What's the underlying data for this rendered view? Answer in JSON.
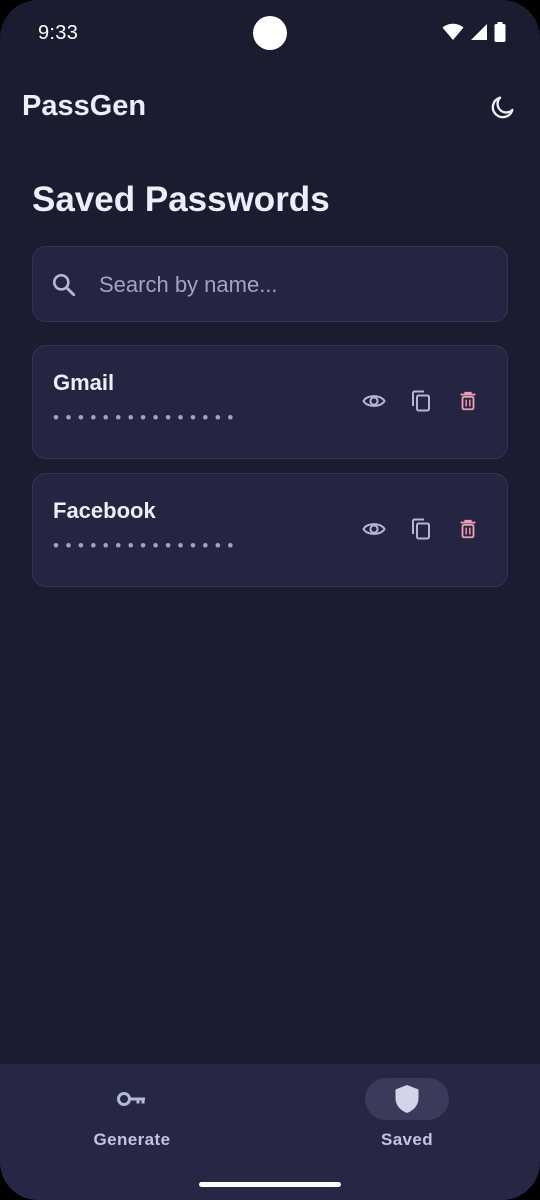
{
  "status_bar": {
    "time": "9:33"
  },
  "app": {
    "title": "PassGen"
  },
  "page": {
    "title": "Saved Passwords"
  },
  "search": {
    "placeholder": "Search by name...",
    "value": ""
  },
  "passwords": [
    {
      "name": "Gmail",
      "masked": "•••••••••••••••",
      "actions": [
        "eye-icon",
        "copy-icon",
        "trash-icon"
      ]
    },
    {
      "name": "Facebook",
      "masked": "•••••••••••••••",
      "actions": [
        "eye-icon",
        "copy-icon",
        "trash-icon"
      ]
    }
  ],
  "bottom_nav": {
    "items": [
      {
        "label": "Generate",
        "icon": "key-icon",
        "active": false
      },
      {
        "label": "Saved",
        "icon": "shield-icon",
        "active": true
      }
    ]
  },
  "colors": {
    "background": "#1c1c30",
    "surface": "#252541",
    "nav_background": "#262645",
    "text_primary": "#eeeef8",
    "text_secondary": "#a2a2c4",
    "icon_accent": "#b4b8d8",
    "delete_accent": "#f0a0b0"
  }
}
